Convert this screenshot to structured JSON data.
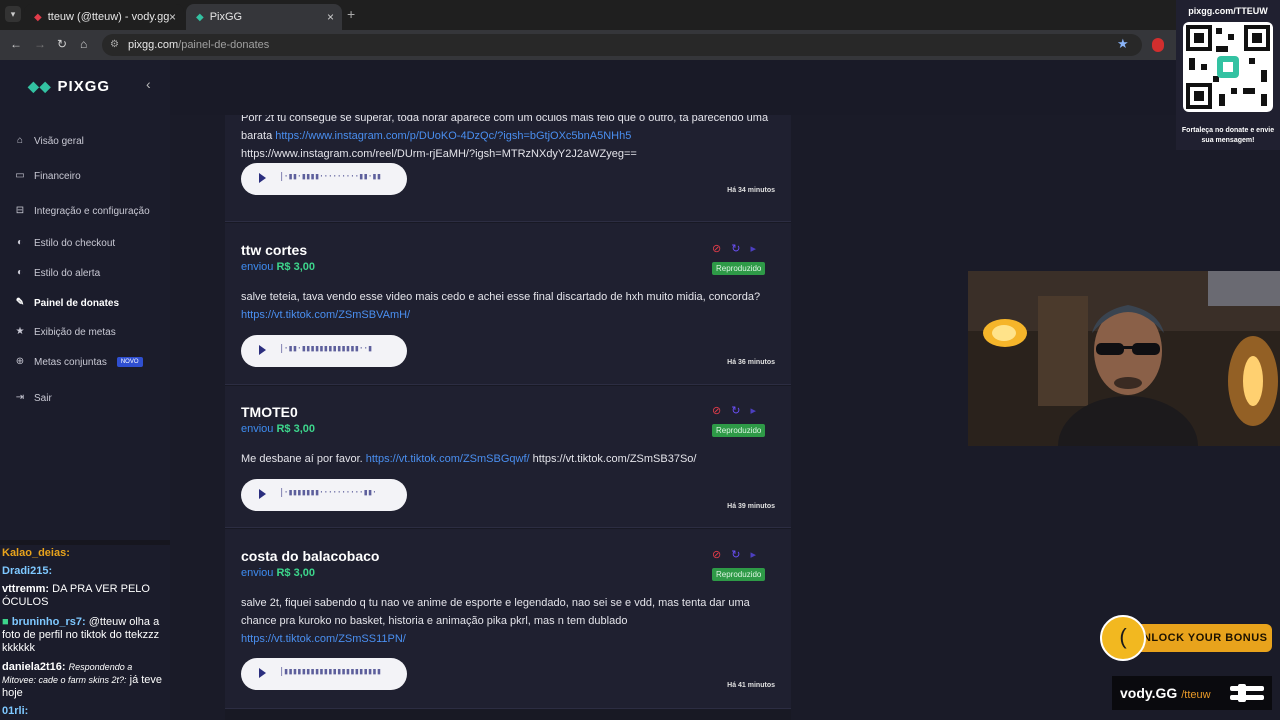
{
  "browser": {
    "tabs": [
      {
        "title": "tteuw (@tteuw) - vody.gg",
        "close": "×"
      },
      {
        "title": "PixGG",
        "close": "×"
      }
    ],
    "new_tab": "+",
    "url_host": "pixgg.com",
    "url_path": "/painel-de-donates"
  },
  "sidebar": {
    "brand": "PIXGG",
    "items": [
      {
        "label": "Visão geral",
        "icon": "home-icon"
      },
      {
        "label": "Financeiro",
        "icon": "wallet-icon"
      },
      {
        "label": "Integração e configuração",
        "icon": "plug-icon"
      },
      {
        "label": "Estilo do checkout",
        "icon": "palette-icon"
      },
      {
        "label": "Estilo do alerta",
        "icon": "palette-icon"
      },
      {
        "label": "Painel de donates",
        "icon": "brush-icon"
      },
      {
        "label": "Exibição de metas",
        "icon": "star-icon"
      },
      {
        "label": "Metas conjuntas",
        "icon": "target-icon",
        "badge": "NOVO"
      },
      {
        "label": "Sair",
        "icon": "logout-icon"
      }
    ]
  },
  "donations": [
    {
      "donor": "",
      "message_parts": [
        {
          "text": "Porr 2t tu consegue se superar, toda horar aparece com um óculos mais feio que o outro, tá parecendo uma barata ",
          "link": false
        },
        {
          "text": "https://www.instagram.com/p/DUoKO-4DzQc/?igsh=bGtjOXc5bnA5NHh5",
          "link": true
        },
        {
          "text": " https://www.instagram.com/reel/DUrm-rjEaMH/?igsh=MTRzNXdyY2J2aWZyeg==",
          "link": false
        }
      ],
      "wave": "|·▮▮·▮▮▮▮·········▮▮·▮▮",
      "time": "Há 34 minutos"
    },
    {
      "donor": "ttw cortes",
      "sent_label": "enviou",
      "amount": "R$ 3,00",
      "status": "Reproduzido",
      "message_parts": [
        {
          "text": "salve teteia, tava vendo esse video mais cedo e achei esse final discartado de hxh muito midia, concorda? ",
          "link": false
        },
        {
          "text": "https://vt.tiktok.com/ZSmSBVAmH/",
          "link": true
        }
      ],
      "wave": "|·▮▮·▮▮▮▮▮▮▮▮▮▮▮▮▮··▮",
      "time": "Há 36 minutos"
    },
    {
      "donor": "TMOTE0",
      "sent_label": "enviou",
      "amount": "R$ 3,00",
      "status": "Reproduzido",
      "message_parts": [
        {
          "text": "Me desbane aí por favor. ",
          "link": false
        },
        {
          "text": "https://vt.tiktok.com/ZSmSBGqwf/",
          "link": true
        },
        {
          "text": " https://vt.tiktok.com/ZSmSB37So/",
          "link": false
        }
      ],
      "wave": "|·▮▮▮▮▮▮▮··········▮▮·",
      "time": "Há 39 minutos"
    },
    {
      "donor": "costa do balacobaco",
      "sent_label": "enviou",
      "amount": "R$ 3,00",
      "status": "Reproduzido",
      "message_parts": [
        {
          "text": "salve 2t, fiquei sabendo q tu nao ve anime de esporte e legendado, nao sei se e vdd, mas tenta dar uma chance pra kuroko no basket, historia e animação pika pkrl, mas n tem dublado ",
          "link": false
        },
        {
          "text": "https://vt.tiktok.com/ZSmSS11PN/",
          "link": true
        }
      ],
      "wave": "|▮▮▮▮▮▮▮▮▮▮▮▮▮▮▮▮▮▮▮▮▮▮",
      "time": "Há 41 minutos"
    }
  ],
  "overlay": {
    "qr_url": "pixgg.com/TTEUW",
    "qr_caption": "Fortaleça no donate e envie sua mensagem!",
    "unlock": "UNLOCK YOUR BONUS",
    "vody": "vody.GG",
    "vody_handle": "/tteuw"
  },
  "chat": [
    {
      "user": "Kalao_deias:",
      "text": "",
      "color": "#e8a31c"
    },
    {
      "user": "Dradi215:",
      "text": "",
      "color": "#7ec8ff"
    },
    {
      "user": "vttremm:",
      "text": "DA PRA VER PELO ÓCULOS",
      "color": "#ffffff"
    },
    {
      "user": "bruninho_rs7:",
      "text": "@tteuw olha a foto de perfil no tiktok do ttekzzz kkkkkk",
      "color": "#7ec8ff"
    },
    {
      "user": "daniela2t16:",
      "reply": "Respondendo a Mitovee: cade o farm skins 2t?:",
      "text": "já teve hoje",
      "color": "#ffffff"
    },
    {
      "user": "01rli:",
      "text": "",
      "color": "#7ec8ff"
    }
  ]
}
